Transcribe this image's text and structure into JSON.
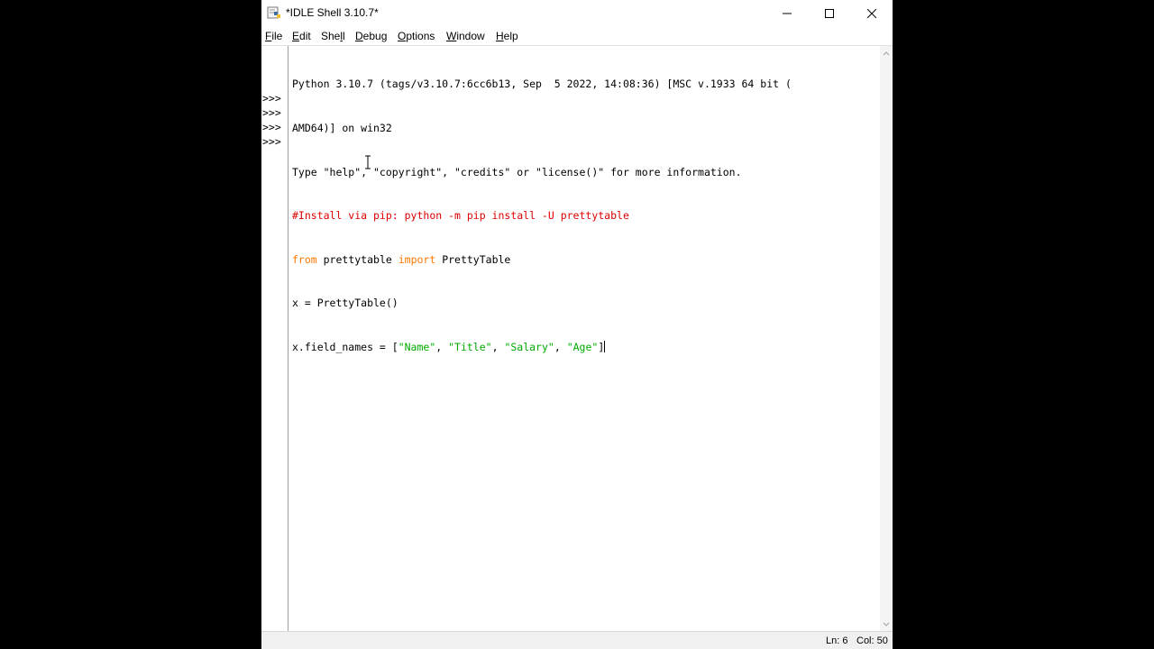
{
  "window": {
    "title": "*IDLE Shell 3.10.7*"
  },
  "menu": {
    "items": [
      "File",
      "Edit",
      "Shell",
      "Debug",
      "Options",
      "Window",
      "Help"
    ]
  },
  "prompt": ">>>",
  "shell": {
    "banner": [
      "Python 3.10.7 (tags/v3.10.7:6cc6b13, Sep  5 2022, 14:08:36) [MSC v.1933 64 bit (",
      "AMD64)] on win32",
      "Type \"help\", \"copyright\", \"credits\" or \"license()\" for more information."
    ],
    "lines": [
      {
        "comment": "#Install via pip: python -m pip install -U prettytable"
      },
      {
        "kw1": "from",
        "mid": " prettytable ",
        "kw2": "import",
        "rest": " PrettyTable"
      },
      {
        "text": "x = PrettyTable()"
      },
      {
        "prefix": "x.field_names = [",
        "s1": "\"Name\"",
        "sep1": ", ",
        "s2": "\"Title\"",
        "sep2": ", ",
        "s3": "\"Salary\"",
        "sep3": ", ",
        "s4": "\"Age\"",
        "suffix": "]"
      }
    ]
  },
  "status": {
    "ln": "Ln: 6",
    "col": "Col: 50"
  },
  "colors": {
    "comment": "#dd0000",
    "keyword": "#ff7700",
    "string": "#00aa00"
  }
}
